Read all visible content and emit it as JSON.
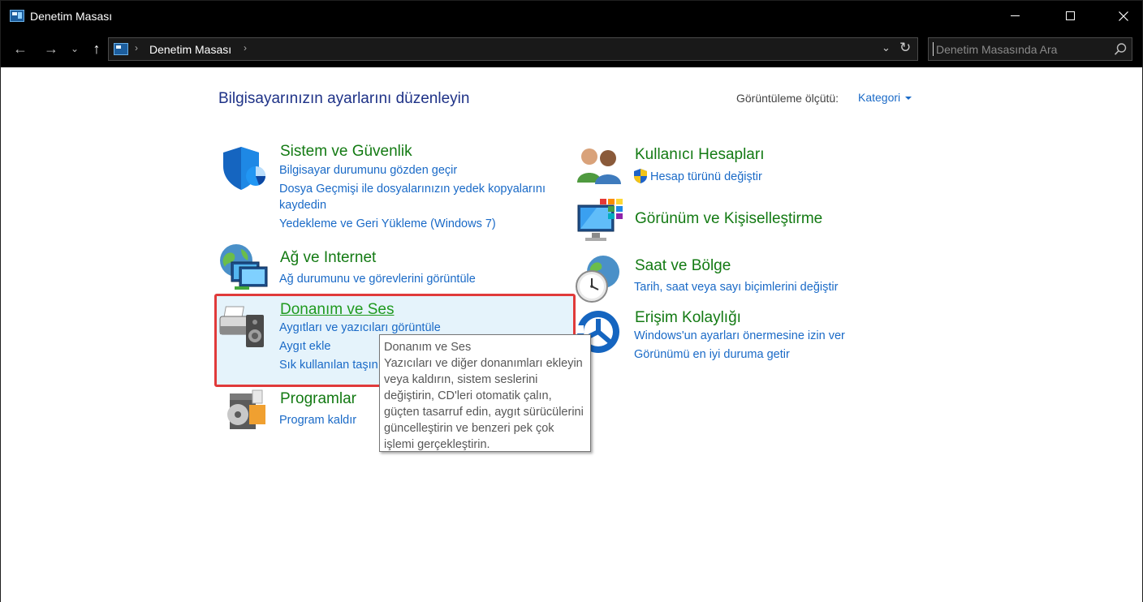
{
  "window": {
    "title": "Denetim Masası",
    "controls": {
      "minimize": "—",
      "maximize": "□",
      "close": "✕"
    }
  },
  "nav": {
    "back": "←",
    "forward": "→",
    "recent": "⌄",
    "up": "↑"
  },
  "address": {
    "crumb": "Denetim Masası",
    "separator": "›",
    "dropdown": "⌄",
    "refresh": "↻"
  },
  "search": {
    "placeholder": "Denetim Masasında Ara"
  },
  "page": {
    "heading": "Bilgisayarınızın ayarlarını düzenleyin",
    "view_by_label": "Görüntüleme ölçütü:",
    "view_by_value": "Kategori"
  },
  "categories": {
    "system": {
      "title": "Sistem ve Güvenlik",
      "links": [
        "Bilgisayar durumunu gözden geçir",
        "Dosya Geçmişi ile dosyalarınızın yedek kopyalarını",
        "kaydedin",
        "Yedekleme ve Geri Yükleme (Windows 7)"
      ]
    },
    "network": {
      "title": "Ağ ve Internet",
      "links": [
        "Ağ durumunu ve görevlerini görüntüle"
      ]
    },
    "hardware": {
      "title": "Donanım ve Ses",
      "links": [
        "Aygıtları ve yazıcıları görüntüle",
        "Aygıt ekle",
        "Sık kullanılan taşın"
      ]
    },
    "programs": {
      "title": "Programlar",
      "links": [
        "Program kaldır"
      ]
    },
    "users": {
      "title": "Kullanıcı Hesapları",
      "links": [
        "Hesap türünü değiştir"
      ]
    },
    "appearance": {
      "title": "Görünüm ve Kişiselleştirme",
      "links": []
    },
    "clock": {
      "title": "Saat ve Bölge",
      "links": [
        "Tarih, saat veya sayı biçimlerini değiştir"
      ]
    },
    "access": {
      "title": "Erişim Kolaylığı",
      "links": [
        "Windows'un ayarları önermesine izin ver",
        "Görünümü en iyi duruma getir"
      ]
    }
  },
  "tooltip": {
    "lines": [
      "Donanım ve Ses",
      "Yazıcıları ve diğer donanımları ekleyin",
      "veya kaldırın, sistem seslerini",
      "değiştirin, CD'leri otomatik çalın,",
      "güçten tasarruf edin, aygıt sürücülerini",
      "güncelleştirin ve benzeri pek çok",
      "işlemi gerçekleştirin."
    ]
  },
  "colors": {
    "heading": "#1e3287",
    "category_title": "#137a13",
    "link": "#1a6ac7",
    "highlight_border": "#e03a3a",
    "hover_background": "#e5f3fb"
  }
}
